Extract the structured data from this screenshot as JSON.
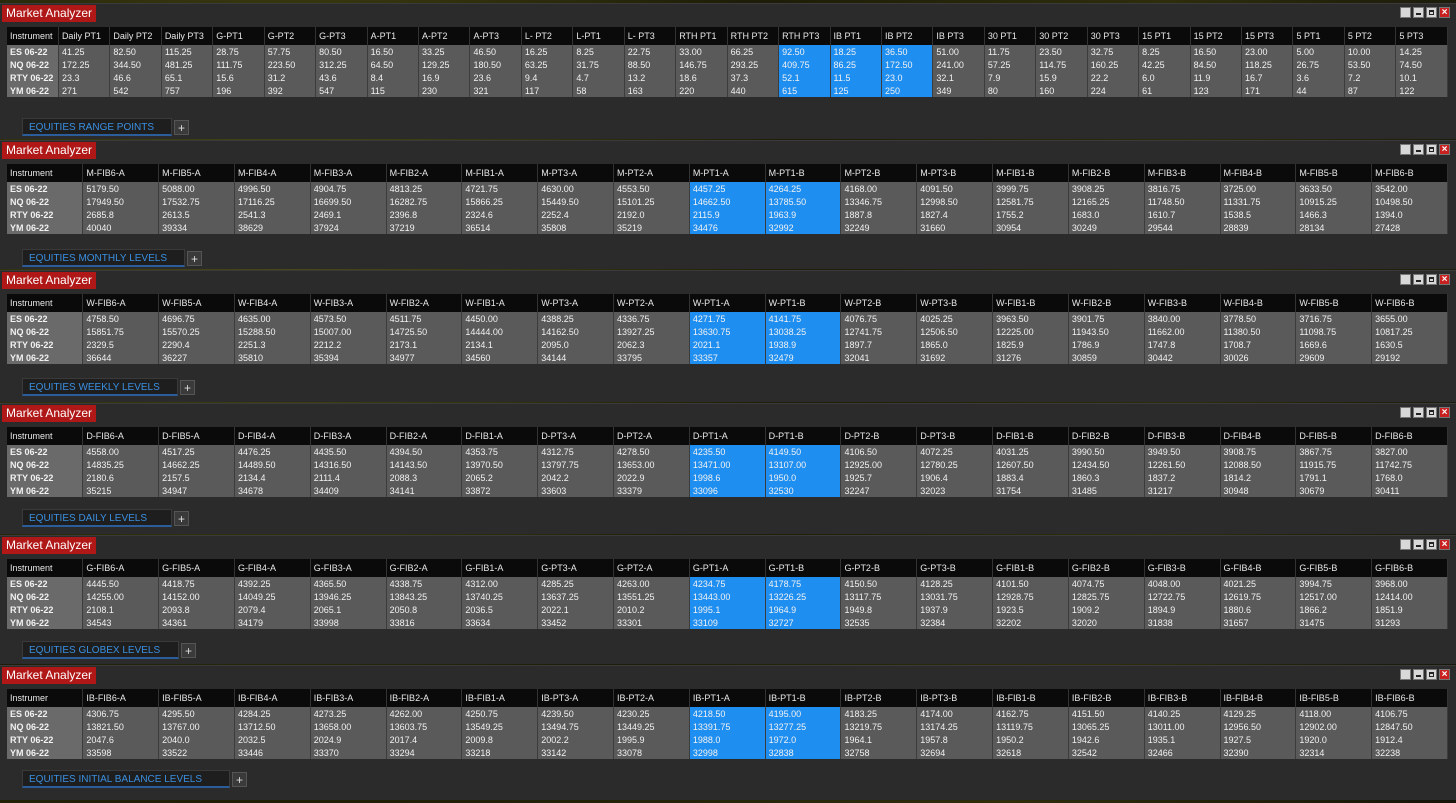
{
  "window_title": "Market Analyzer",
  "instruments": [
    "ES 06-22",
    "NQ 06-22",
    "RTY 06-22",
    "YM 06-22"
  ],
  "panels": [
    {
      "tab_label": "EQUITIES RANGE POINTS",
      "highlight": [
        15,
        16,
        17
      ],
      "headers": [
        "Instrument",
        "Daily PT1",
        "Daily PT2",
        "Daily PT3",
        "G-PT1",
        "G-PT2",
        "G-PT3",
        "A-PT1",
        "A-PT2",
        "A-PT3",
        "L- PT2",
        "L-PT1",
        "L- PT3",
        "RTH PT1",
        "RTH PT2",
        "RTH PT3",
        "IB PT1",
        "IB PT2",
        "IB PT3",
        "30 PT1",
        "30 PT2",
        "30 PT3",
        "15 PT1",
        "15 PT2",
        "15 PT3",
        "5 PT1",
        "5 PT2",
        "5 PT3"
      ],
      "rows": [
        [
          "ES 06-22",
          "41.25",
          "82.50",
          "115.25",
          "28.75",
          "57.75",
          "80.50",
          "16.50",
          "33.25",
          "46.50",
          "16.25",
          "8.25",
          "22.75",
          "33.00",
          "66.25",
          "92.50",
          "18.25",
          "36.50",
          "51.00",
          "11.75",
          "23.50",
          "32.75",
          "8.25",
          "16.50",
          "23.00",
          "5.00",
          "10.00",
          "14.25"
        ],
        [
          "NQ 06-22",
          "172.25",
          "344.50",
          "481.25",
          "111.75",
          "223.50",
          "312.25",
          "64.50",
          "129.25",
          "180.50",
          "63.25",
          "31.75",
          "88.50",
          "146.75",
          "293.25",
          "409.75",
          "86.25",
          "172.50",
          "241.00",
          "57.25",
          "114.75",
          "160.25",
          "42.25",
          "84.50",
          "118.25",
          "26.75",
          "53.50",
          "74.50"
        ],
        [
          "RTY 06-22",
          "23.3",
          "46.6",
          "65.1",
          "15.6",
          "31.2",
          "43.6",
          "8.4",
          "16.9",
          "23.6",
          "9.4",
          "4.7",
          "13.2",
          "18.6",
          "37.3",
          "52.1",
          "11.5",
          "23.0",
          "32.1",
          "7.9",
          "15.9",
          "22.2",
          "6.0",
          "11.9",
          "16.7",
          "3.6",
          "7.2",
          "10.1"
        ],
        [
          "YM 06-22",
          "271",
          "542",
          "757",
          "196",
          "392",
          "547",
          "115",
          "230",
          "321",
          "117",
          "58",
          "163",
          "220",
          "440",
          "615",
          "125",
          "250",
          "349",
          "80",
          "160",
          "224",
          "61",
          "123",
          "171",
          "44",
          "87",
          "122"
        ]
      ]
    },
    {
      "tab_label": "EQUITIES MONTHLY LEVELS",
      "highlight": [
        9,
        10
      ],
      "headers": [
        "Instrument",
        "M-FIB6-A",
        "M-FIB5-A",
        "M-FIB4-A",
        "M-FIB3-A",
        "M-FIB2-A",
        "M-FIB1-A",
        "M-PT3-A",
        "M-PT2-A",
        "M-PT1-A",
        "M-PT1-B",
        "M-PT2-B",
        "M-PT3-B",
        "M-FIB1-B",
        "M-FIB2-B",
        "M-FIB3-B",
        "M-FIB4-B",
        "M-FIB5-B",
        "M-FIB6-B"
      ],
      "rows": [
        [
          "ES 06-22",
          "5179.50",
          "5088.00",
          "4996.50",
          "4904.75",
          "4813.25",
          "4721.75",
          "4630.00",
          "4553.50",
          "4457.25",
          "4264.25",
          "4168.00",
          "4091.50",
          "3999.75",
          "3908.25",
          "3816.75",
          "3725.00",
          "3633.50",
          "3542.00"
        ],
        [
          "NQ 06-22",
          "17949.50",
          "17532.75",
          "17116.25",
          "16699.50",
          "16282.75",
          "15866.25",
          "15449.50",
          "15101.25",
          "14662.50",
          "13785.50",
          "13346.75",
          "12998.50",
          "12581.75",
          "12165.25",
          "11748.50",
          "11331.75",
          "10915.25",
          "10498.50"
        ],
        [
          "RTY 06-22",
          "2685.8",
          "2613.5",
          "2541.3",
          "2469.1",
          "2396.8",
          "2324.6",
          "2252.4",
          "2192.0",
          "2115.9",
          "1963.9",
          "1887.8",
          "1827.4",
          "1755.2",
          "1683.0",
          "1610.7",
          "1538.5",
          "1466.3",
          "1394.0"
        ],
        [
          "YM 06-22",
          "40040",
          "39334",
          "38629",
          "37924",
          "37219",
          "36514",
          "35808",
          "35219",
          "34476",
          "32992",
          "32249",
          "31660",
          "30954",
          "30249",
          "29544",
          "28839",
          "28134",
          "27428"
        ]
      ]
    },
    {
      "tab_label": "EQUITIES WEEKLY LEVELS",
      "highlight": [
        9,
        10
      ],
      "headers": [
        "Instrument",
        "W-FIB6-A",
        "W-FIB5-A",
        "W-FIB4-A",
        "W-FIB3-A",
        "W-FIB2-A",
        "W-FIB1-A",
        "W-PT3-A",
        "W-PT2-A",
        "W-PT1-A",
        "W-PT1-B",
        "W-PT2-B",
        "W-PT3-B",
        "W-FIB1-B",
        "W-FIB2-B",
        "W-FIB3-B",
        "W-FIB4-B",
        "W-FIB5-B",
        "W-FIB6-B"
      ],
      "rows": [
        [
          "ES 06-22",
          "4758.50",
          "4696.75",
          "4635.00",
          "4573.50",
          "4511.75",
          "4450.00",
          "4388.25",
          "4336.75",
          "4271.75",
          "4141.75",
          "4076.75",
          "4025.25",
          "3963.50",
          "3901.75",
          "3840.00",
          "3778.50",
          "3716.75",
          "3655.00"
        ],
        [
          "NQ 06-22",
          "15851.75",
          "15570.25",
          "15288.50",
          "15007.00",
          "14725.50",
          "14444.00",
          "14162.50",
          "13927.25",
          "13630.75",
          "13038.25",
          "12741.75",
          "12506.50",
          "12225.00",
          "11943.50",
          "11662.00",
          "11380.50",
          "11098.75",
          "10817.25"
        ],
        [
          "RTY 06-22",
          "2329.5",
          "2290.4",
          "2251.3",
          "2212.2",
          "2173.1",
          "2134.1",
          "2095.0",
          "2062.3",
          "2021.1",
          "1938.9",
          "1897.7",
          "1865.0",
          "1825.9",
          "1786.9",
          "1747.8",
          "1708.7",
          "1669.6",
          "1630.5"
        ],
        [
          "YM 06-22",
          "36644",
          "36227",
          "35810",
          "35394",
          "34977",
          "34560",
          "34144",
          "33795",
          "33357",
          "32479",
          "32041",
          "31692",
          "31276",
          "30859",
          "30442",
          "30026",
          "29609",
          "29192"
        ]
      ]
    },
    {
      "tab_label": "EQUITIES DAILY LEVELS",
      "highlight": [
        9,
        10
      ],
      "headers": [
        "Instrument",
        "D-FIB6-A",
        "D-FIB5-A",
        "D-FIB4-A",
        "D-FIB3-A",
        "D-FIB2-A",
        "D-FIB1-A",
        "D-PT3-A",
        "D-PT2-A",
        "D-PT1-A",
        "D-PT1-B",
        "D-PT2-B",
        "D-PT3-B",
        "D-FIB1-B",
        "D-FIB2-B",
        "D-FIB3-B",
        "D-FIB4-B",
        "D-FIB5-B",
        "D-FIB6-B"
      ],
      "rows": [
        [
          "ES 06-22",
          "4558.00",
          "4517.25",
          "4476.25",
          "4435.50",
          "4394.50",
          "4353.75",
          "4312.75",
          "4278.50",
          "4235.50",
          "4149.50",
          "4106.50",
          "4072.25",
          "4031.25",
          "3990.50",
          "3949.50",
          "3908.75",
          "3867.75",
          "3827.00"
        ],
        [
          "NQ 06-22",
          "14835.25",
          "14662.25",
          "14489.50",
          "14316.50",
          "14143.50",
          "13970.50",
          "13797.75",
          "13653.00",
          "13471.00",
          "13107.00",
          "12925.00",
          "12780.25",
          "12607.50",
          "12434.50",
          "12261.50",
          "12088.50",
          "11915.75",
          "11742.75"
        ],
        [
          "RTY 06-22",
          "2180.6",
          "2157.5",
          "2134.4",
          "2111.4",
          "2088.3",
          "2065.2",
          "2042.2",
          "2022.9",
          "1998.6",
          "1950.0",
          "1925.7",
          "1906.4",
          "1883.4",
          "1860.3",
          "1837.2",
          "1814.2",
          "1791.1",
          "1768.0"
        ],
        [
          "YM 06-22",
          "35215",
          "34947",
          "34678",
          "34409",
          "34141",
          "33872",
          "33603",
          "33379",
          "33096",
          "32530",
          "32247",
          "32023",
          "31754",
          "31485",
          "31217",
          "30948",
          "30679",
          "30411"
        ]
      ]
    },
    {
      "tab_label": "EQUITIES GLOBEX LEVELS",
      "highlight": [
        9,
        10
      ],
      "headers": [
        "Instrument",
        "G-FIB6-A",
        "G-FIB5-A",
        "G-FIB4-A",
        "G-FIB3-A",
        "G-FIB2-A",
        "G-FIB1-A",
        "G-PT3-A",
        "G-PT2-A",
        "G-PT1-A",
        "G-PT1-B",
        "G-PT2-B",
        "G-PT3-B",
        "G-FIB1-B",
        "G-FIB2-B",
        "G-FIB3-B",
        "G-FIB4-B",
        "G-FIB5-B",
        "G-FIB6-B"
      ],
      "rows": [
        [
          "ES 06-22",
          "4445.50",
          "4418.75",
          "4392.25",
          "4365.50",
          "4338.75",
          "4312.00",
          "4285.25",
          "4263.00",
          "4234.75",
          "4178.75",
          "4150.50",
          "4128.25",
          "4101.50",
          "4074.75",
          "4048.00",
          "4021.25",
          "3994.75",
          "3968.00"
        ],
        [
          "NQ 06-22",
          "14255.00",
          "14152.00",
          "14049.25",
          "13946.25",
          "13843.25",
          "13740.25",
          "13637.25",
          "13551.25",
          "13443.00",
          "13226.25",
          "13117.75",
          "13031.75",
          "12928.75",
          "12825.75",
          "12722.75",
          "12619.75",
          "12517.00",
          "12414.00"
        ],
        [
          "RTY 06-22",
          "2108.1",
          "2093.8",
          "2079.4",
          "2065.1",
          "2050.8",
          "2036.5",
          "2022.1",
          "2010.2",
          "1995.1",
          "1964.9",
          "1949.8",
          "1937.9",
          "1923.5",
          "1909.2",
          "1894.9",
          "1880.6",
          "1866.2",
          "1851.9"
        ],
        [
          "YM 06-22",
          "34543",
          "34361",
          "34179",
          "33998",
          "33816",
          "33634",
          "33452",
          "33301",
          "33109",
          "32727",
          "32535",
          "32384",
          "32202",
          "32020",
          "31838",
          "31657",
          "31475",
          "31293"
        ]
      ]
    },
    {
      "tab_label": "EQUITIES INITIAL BALANCE LEVELS",
      "highlight": [
        9,
        10
      ],
      "headers": [
        "Instrumer",
        "IB-FIB6-A",
        "IB-FIB5-A",
        "IB-FIB4-A",
        "IB-FIB3-A",
        "IB-FIB2-A",
        "IB-FIB1-A",
        "IB-PT3-A",
        "IB-PT2-A",
        "IB-PT1-A",
        "IB-PT1-B",
        "IB-PT2-B",
        "IB-PT3-B",
        "IB-FIB1-B",
        "IB-FIB2-B",
        "IB-FIB3-B",
        "IB-FIB4-B",
        "IB-FIB5-B",
        "IB-FIB6-B"
      ],
      "rows": [
        [
          "ES 06-22",
          "4306.75",
          "4295.50",
          "4284.25",
          "4273.25",
          "4262.00",
          "4250.75",
          "4239.50",
          "4230.25",
          "4218.50",
          "4195.00",
          "4183.25",
          "4174.00",
          "4162.75",
          "4151.50",
          "4140.25",
          "4129.25",
          "4118.00",
          "4106.75"
        ],
        [
          "NQ 06-22",
          "13821.50",
          "13767.00",
          "13712.50",
          "13658.00",
          "13603.75",
          "13549.25",
          "13494.75",
          "13449.25",
          "13391.75",
          "13277.25",
          "13219.75",
          "13174.25",
          "13119.75",
          "13065.25",
          "13011.00",
          "12956.50",
          "12902.00",
          "12847.50"
        ],
        [
          "RTY 06-22",
          "2047.6",
          "2040.0",
          "2032.5",
          "2024.9",
          "2017.4",
          "2009.8",
          "2002.2",
          "1995.9",
          "1988.0",
          "1972.0",
          "1964.1",
          "1957.8",
          "1950.2",
          "1942.6",
          "1935.1",
          "1927.5",
          "1920.0",
          "1912.4"
        ],
        [
          "YM 06-22",
          "33598",
          "33522",
          "33446",
          "33370",
          "33294",
          "33218",
          "33142",
          "33078",
          "32998",
          "32838",
          "32758",
          "32694",
          "32618",
          "32542",
          "32466",
          "32390",
          "32314",
          "32238"
        ]
      ]
    }
  ]
}
